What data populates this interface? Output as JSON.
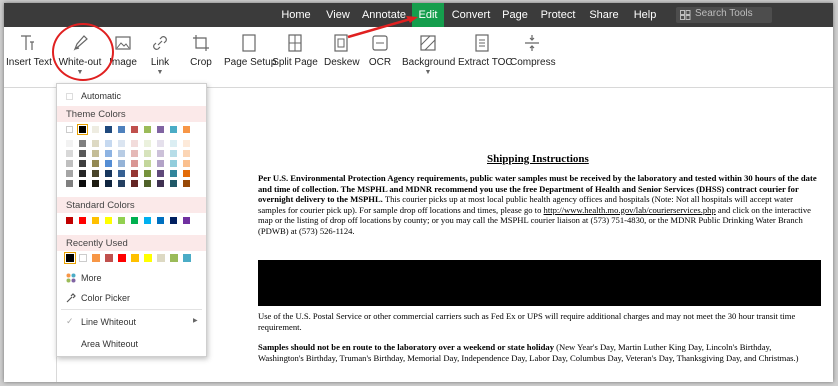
{
  "menubar": {
    "items": [
      "Home",
      "View",
      "Annotate",
      "Edit",
      "Convert",
      "Page",
      "Protect",
      "Share",
      "Help"
    ],
    "active": "Edit",
    "search_placeholder": "Search Tools"
  },
  "ribbon": {
    "tools": [
      "Insert Text",
      "White-out",
      "Image",
      "Link",
      "Crop",
      "Page Setup",
      "Split Page",
      "Deskew",
      "OCR",
      "Background",
      "Extract TOC",
      "Compress"
    ]
  },
  "whiteout_menu": {
    "automatic": "Automatic",
    "theme_colors": "Theme Colors",
    "standard_colors": "Standard Colors",
    "recently_used": "Recently Used",
    "more": "More",
    "color_picker": "Color Picker",
    "line_whiteout": "Line Whiteout",
    "area_whiteout": "Area Whiteout",
    "theme_top_row": [
      "#ffffff",
      "#000000",
      "#eeece1",
      "#1f497d",
      "#4f81bd",
      "#c0504d",
      "#9bbb59",
      "#8064a2",
      "#4bacc6",
      "#f79646"
    ],
    "theme_shades": [
      [
        "#f2f2f2",
        "#7f7f7f",
        "#ddd9c3",
        "#c6d9f0",
        "#dbe5f1",
        "#f2dcdb",
        "#ebf1dd",
        "#e5e0ec",
        "#dbeef3",
        "#fdeada"
      ],
      [
        "#d8d8d8",
        "#595959",
        "#c4bd97",
        "#8db3e2",
        "#b8cce4",
        "#e5b9b7",
        "#d7e3bc",
        "#ccc1d9",
        "#b7dde8",
        "#fbd5b5"
      ],
      [
        "#bfbfbf",
        "#3f3f3f",
        "#938953",
        "#548dd4",
        "#95b3d7",
        "#d99694",
        "#c3d69b",
        "#b2a2c7",
        "#92cddc",
        "#fac08f"
      ],
      [
        "#a5a5a5",
        "#262626",
        "#494429",
        "#17365d",
        "#366092",
        "#953734",
        "#76923c",
        "#5f497a",
        "#31859b",
        "#e36c09"
      ],
      [
        "#7f7f7f",
        "#0c0c0c",
        "#1d1b10",
        "#0f243e",
        "#244061",
        "#632423",
        "#4f6128",
        "#3f3151",
        "#205867",
        "#974806"
      ]
    ],
    "standard": [
      "#c00000",
      "#ff0000",
      "#ffc000",
      "#ffff00",
      "#92d050",
      "#00b050",
      "#00b0f0",
      "#0070c0",
      "#002060",
      "#7030a0"
    ],
    "recent": [
      "#000000",
      "#ffffff",
      "#f79646",
      "#c0504d",
      "#ff0000",
      "#ffc000",
      "#ffff00",
      "#ddd9c3",
      "#9bbb59",
      "#4bacc6"
    ]
  },
  "document": {
    "heading": "Shipping Instructions",
    "p1_bold": "Per U.S. Environmental Protection Agency requirements, public water samples must be received by the laboratory and tested within 30 hours of the date and time of collection. The MSPHL and MDNR recommend you use the free Department of Health and Senior Services (DHSS) contract courier for overnight delivery to the MSPHL.",
    "p1_rest": " This courier picks up at most local public health agency offices and hospitals (Note: Not all hospitals will accept water samples for courier pick up). For sample drop off locations and times, please go to ",
    "p1_link": "http://www.health.mo.gov/lab/courierservices.php",
    "p1_end": " and click on the interactive map or the listing of drop off locations by county; or you may call the MSPHL courier liaison at (573) 751-4830, or the MDNR Public Drinking Water Branch (PDWB) at (573) 526-1124.",
    "p2": "Use of the U.S. Postal Service or other commercial carriers such as Fed Ex or UPS will require additional charges and may not meet the 30 hour transit time requirement.",
    "p3_bold": "Samples should not be en route to the laboratory over a weekend or state holiday",
    "p3_rest": " (New Year's Day, Martin Luther King Day, Lincoln's Birthday, Washington's Birthday, Truman's Birthday, Memorial Day, Independence Day, Labor Day, Columbus Day, Veteran's Day, Thanksgiving Day, and Christmas.)"
  }
}
